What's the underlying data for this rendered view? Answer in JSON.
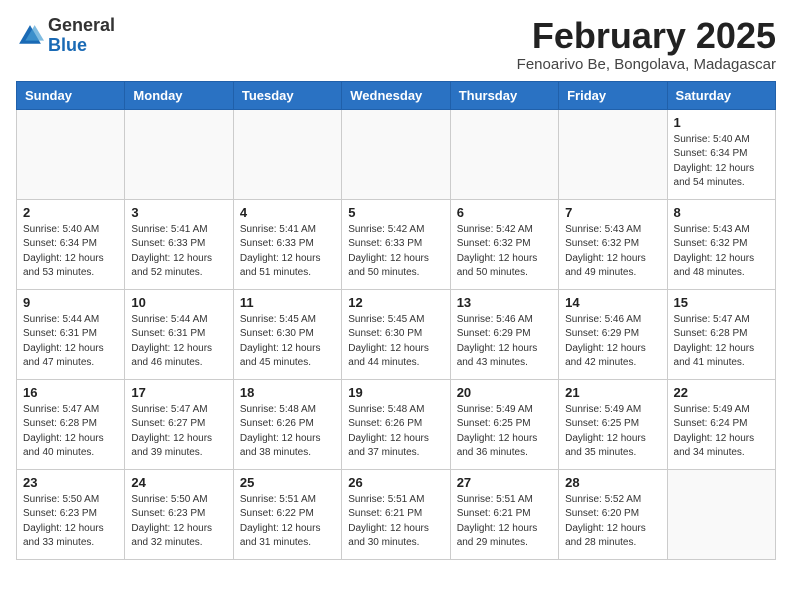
{
  "header": {
    "logo_line1": "General",
    "logo_line2": "Blue",
    "month_year": "February 2025",
    "location": "Fenoarivo Be, Bongolava, Madagascar"
  },
  "weekdays": [
    "Sunday",
    "Monday",
    "Tuesday",
    "Wednesday",
    "Thursday",
    "Friday",
    "Saturday"
  ],
  "weeks": [
    [
      {
        "day": "",
        "info": ""
      },
      {
        "day": "",
        "info": ""
      },
      {
        "day": "",
        "info": ""
      },
      {
        "day": "",
        "info": ""
      },
      {
        "day": "",
        "info": ""
      },
      {
        "day": "",
        "info": ""
      },
      {
        "day": "1",
        "info": "Sunrise: 5:40 AM\nSunset: 6:34 PM\nDaylight: 12 hours and 54 minutes."
      }
    ],
    [
      {
        "day": "2",
        "info": "Sunrise: 5:40 AM\nSunset: 6:34 PM\nDaylight: 12 hours and 53 minutes."
      },
      {
        "day": "3",
        "info": "Sunrise: 5:41 AM\nSunset: 6:33 PM\nDaylight: 12 hours and 52 minutes."
      },
      {
        "day": "4",
        "info": "Sunrise: 5:41 AM\nSunset: 6:33 PM\nDaylight: 12 hours and 51 minutes."
      },
      {
        "day": "5",
        "info": "Sunrise: 5:42 AM\nSunset: 6:33 PM\nDaylight: 12 hours and 50 minutes."
      },
      {
        "day": "6",
        "info": "Sunrise: 5:42 AM\nSunset: 6:32 PM\nDaylight: 12 hours and 50 minutes."
      },
      {
        "day": "7",
        "info": "Sunrise: 5:43 AM\nSunset: 6:32 PM\nDaylight: 12 hours and 49 minutes."
      },
      {
        "day": "8",
        "info": "Sunrise: 5:43 AM\nSunset: 6:32 PM\nDaylight: 12 hours and 48 minutes."
      }
    ],
    [
      {
        "day": "9",
        "info": "Sunrise: 5:44 AM\nSunset: 6:31 PM\nDaylight: 12 hours and 47 minutes."
      },
      {
        "day": "10",
        "info": "Sunrise: 5:44 AM\nSunset: 6:31 PM\nDaylight: 12 hours and 46 minutes."
      },
      {
        "day": "11",
        "info": "Sunrise: 5:45 AM\nSunset: 6:30 PM\nDaylight: 12 hours and 45 minutes."
      },
      {
        "day": "12",
        "info": "Sunrise: 5:45 AM\nSunset: 6:30 PM\nDaylight: 12 hours and 44 minutes."
      },
      {
        "day": "13",
        "info": "Sunrise: 5:46 AM\nSunset: 6:29 PM\nDaylight: 12 hours and 43 minutes."
      },
      {
        "day": "14",
        "info": "Sunrise: 5:46 AM\nSunset: 6:29 PM\nDaylight: 12 hours and 42 minutes."
      },
      {
        "day": "15",
        "info": "Sunrise: 5:47 AM\nSunset: 6:28 PM\nDaylight: 12 hours and 41 minutes."
      }
    ],
    [
      {
        "day": "16",
        "info": "Sunrise: 5:47 AM\nSunset: 6:28 PM\nDaylight: 12 hours and 40 minutes."
      },
      {
        "day": "17",
        "info": "Sunrise: 5:47 AM\nSunset: 6:27 PM\nDaylight: 12 hours and 39 minutes."
      },
      {
        "day": "18",
        "info": "Sunrise: 5:48 AM\nSunset: 6:26 PM\nDaylight: 12 hours and 38 minutes."
      },
      {
        "day": "19",
        "info": "Sunrise: 5:48 AM\nSunset: 6:26 PM\nDaylight: 12 hours and 37 minutes."
      },
      {
        "day": "20",
        "info": "Sunrise: 5:49 AM\nSunset: 6:25 PM\nDaylight: 12 hours and 36 minutes."
      },
      {
        "day": "21",
        "info": "Sunrise: 5:49 AM\nSunset: 6:25 PM\nDaylight: 12 hours and 35 minutes."
      },
      {
        "day": "22",
        "info": "Sunrise: 5:49 AM\nSunset: 6:24 PM\nDaylight: 12 hours and 34 minutes."
      }
    ],
    [
      {
        "day": "23",
        "info": "Sunrise: 5:50 AM\nSunset: 6:23 PM\nDaylight: 12 hours and 33 minutes."
      },
      {
        "day": "24",
        "info": "Sunrise: 5:50 AM\nSunset: 6:23 PM\nDaylight: 12 hours and 32 minutes."
      },
      {
        "day": "25",
        "info": "Sunrise: 5:51 AM\nSunset: 6:22 PM\nDaylight: 12 hours and 31 minutes."
      },
      {
        "day": "26",
        "info": "Sunrise: 5:51 AM\nSunset: 6:21 PM\nDaylight: 12 hours and 30 minutes."
      },
      {
        "day": "27",
        "info": "Sunrise: 5:51 AM\nSunset: 6:21 PM\nDaylight: 12 hours and 29 minutes."
      },
      {
        "day": "28",
        "info": "Sunrise: 5:52 AM\nSunset: 6:20 PM\nDaylight: 12 hours and 28 minutes."
      },
      {
        "day": "",
        "info": ""
      }
    ]
  ]
}
